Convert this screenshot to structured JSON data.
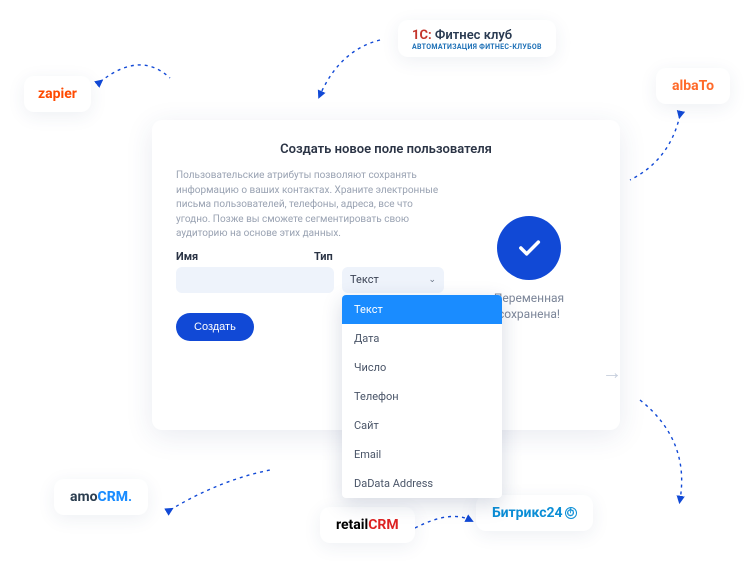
{
  "integrations": {
    "zapier": "zapier",
    "onec_prefix": "1C:",
    "onec_brand": "Фитнес клуб",
    "onec_sub": "АВТОМАТИЗАЦИЯ ФИТНЕС-КЛУБОВ",
    "albato": "albaTo",
    "amocrm": "amoCRM.",
    "retailcrm": "retailCRM",
    "bitrix": "Битрикс24"
  },
  "card": {
    "title": "Создать новое поле пользователя",
    "description": "Пользовательские атрибуты позволяют сохранять информацию о ваших контактах. Храните электронные письма пользователей, телефоны, адреса, все что угодно. Позже вы сможете сегментировать свою аудиторию на основе этих данных.",
    "name_label": "Имя",
    "type_label": "Тип",
    "name_value": "",
    "type_selected": "Текст",
    "options": [
      "Текст",
      "Дата",
      "Число",
      "Телефон",
      "Сайт",
      "Email",
      "DaData Address"
    ],
    "create_button": "Создать",
    "success_text": "Переменная сохранена!"
  },
  "colors": {
    "primary": "#1149d6",
    "dropdown_selected": "#1a8cff",
    "zapier": "#ff4a00",
    "albato": "#ff6a2a",
    "bitrix": "#0b8ed6"
  }
}
